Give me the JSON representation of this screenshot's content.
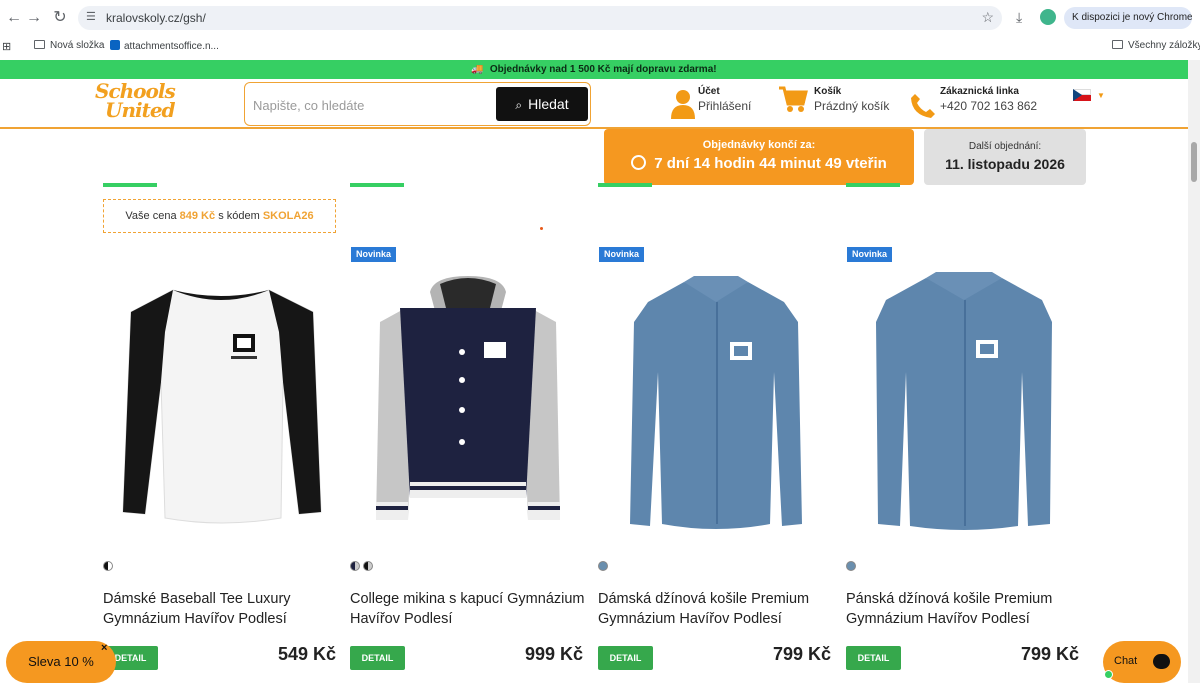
{
  "browser": {
    "url": "kralovskoly.cz/gsh/",
    "profile_label": "K dispozici je nový Chrome",
    "bookmarks": [
      {
        "label": "Nová složka"
      },
      {
        "label": "attachmentsoffice.n..."
      }
    ],
    "all_bookmarks_label": "Všechny záložky"
  },
  "promo": {
    "text": "Objednávky nad 1 500 Kč mají dopravu zdarma!"
  },
  "header": {
    "logo_line1": "Schools",
    "logo_line2": "United",
    "search_placeholder": "Napište, co hledáte",
    "search_button": "Hledat",
    "account": {
      "title": "Účet",
      "subtitle": "Přihlášení"
    },
    "cart": {
      "title": "Košík",
      "subtitle": "Prázdný košík"
    },
    "support": {
      "title": "Zákaznická linka",
      "phone": "+420 702 163 862"
    }
  },
  "countdown": {
    "label": "Objednávky končí za:",
    "value": "7 dní 14 hodin 44 minut 49 vteřin"
  },
  "next_order": {
    "label": "Další objednání:",
    "value": "11. listopadu 2026"
  },
  "price_promo": {
    "prefix": "Vaše cena",
    "price": "849 Kč",
    "middle": "s kódem",
    "code": "SKOLA26"
  },
  "products": [
    {
      "badge": "",
      "title": "Dámské Baseball Tee Luxury Gymnázium Havířov Podlesí",
      "price": "549 Kč",
      "detail": "DETAIL"
    },
    {
      "badge": "Novinka",
      "title": "College mikina s kapucí Gymnázium Havířov Podlesí",
      "price": "999 Kč",
      "detail": "DETAIL"
    },
    {
      "badge": "Novinka",
      "title": "Dámská džínová košile Premium Gymnázium Havířov Podlesí",
      "price": "799 Kč",
      "detail": "DETAIL"
    },
    {
      "badge": "Novinka",
      "title": "Pánská džínová košile Premium Gymnázium Havířov Podlesí",
      "price": "799 Kč",
      "detail": "DETAIL"
    }
  ],
  "floating": {
    "discount_label": "Sleva 10 %",
    "close": "×",
    "chat_label": "Chat"
  },
  "colors": {
    "accent_orange": "#f59820",
    "promo_green": "#36cf63",
    "badge_blue": "#2a7ad6",
    "detail_green": "#36a84c"
  }
}
